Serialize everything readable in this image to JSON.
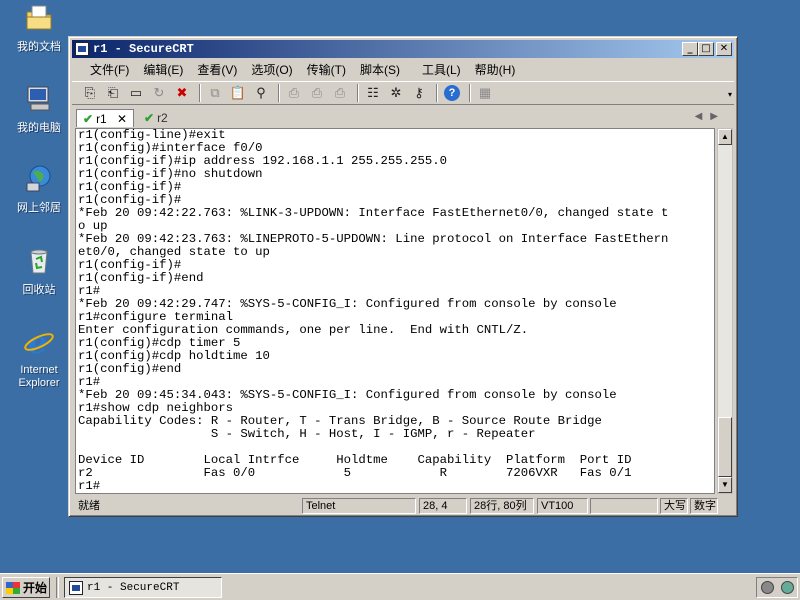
{
  "desktop": {
    "icons": [
      {
        "label": "我的文档",
        "icon": "my-documents-icon"
      },
      {
        "label": "我的电脑",
        "icon": "my-computer-icon"
      },
      {
        "label": "网上邻居",
        "icon": "network-places-icon"
      },
      {
        "label": "回收站",
        "icon": "recycle-bin-icon"
      },
      {
        "label": "Internet Explorer",
        "icon": "internet-explorer-icon"
      }
    ]
  },
  "window": {
    "title": "r1 - SecureCRT",
    "controls": {
      "minimize": "_",
      "maximize": "□",
      "close": "✕"
    }
  },
  "menu": [
    "文件(F)",
    "编辑(E)",
    "查看(V)",
    "选项(O)",
    "传输(T)",
    "脚本(S)",
    "工具(L)",
    "帮助(H)"
  ],
  "tabs": [
    {
      "label": "r1",
      "status": "connected",
      "close": "✕"
    },
    {
      "label": "r2",
      "status": "connected"
    }
  ],
  "terminal": {
    "lines": [
      "r1(config-line)#exit",
      "r1(config)#interface f0/0",
      "r1(config-if)#ip address 192.168.1.1 255.255.255.0",
      "r1(config-if)#no shutdown",
      "r1(config-if)#",
      "r1(config-if)#",
      "*Feb 20 09:42:22.763: %LINK-3-UPDOWN: Interface FastEthernet0/0, changed state t",
      "o up",
      "*Feb 20 09:42:23.763: %LINEPROTO-5-UPDOWN: Line protocol on Interface FastEthern",
      "et0/0, changed state to up",
      "r1(config-if)#",
      "r1(config-if)#end",
      "r1#",
      "*Feb 20 09:42:29.747: %SYS-5-CONFIG_I: Configured from console by console",
      "r1#configure terminal",
      "Enter configuration commands, one per line.  End with CNTL/Z.",
      "r1(config)#cdp timer 5",
      "r1(config)#cdp holdtime 10",
      "r1(config)#end",
      "r1#",
      "*Feb 20 09:45:34.043: %SYS-5-CONFIG_I: Configured from console by console",
      "r1#show cdp neighbors",
      "Capability Codes: R - Router, T - Trans Bridge, B - Source Route Bridge",
      "                  S - Switch, H - Host, I - IGMP, r - Repeater",
      "",
      "Device ID        Local Intrfce     Holdtme    Capability  Platform  Port ID",
      "r2               Fas 0/0            5            R        7206VXR   Fas 0/1",
      "r1#"
    ]
  },
  "status": {
    "ready": "就绪",
    "protocol": "Telnet",
    "cursor": "28,  4",
    "size": "28行, 80列",
    "emulation": "VT100",
    "blank": "",
    "caps": "大写",
    "num": "数字"
  },
  "taskbar": {
    "start": "开始",
    "task": "r1 - SecureCRT"
  }
}
